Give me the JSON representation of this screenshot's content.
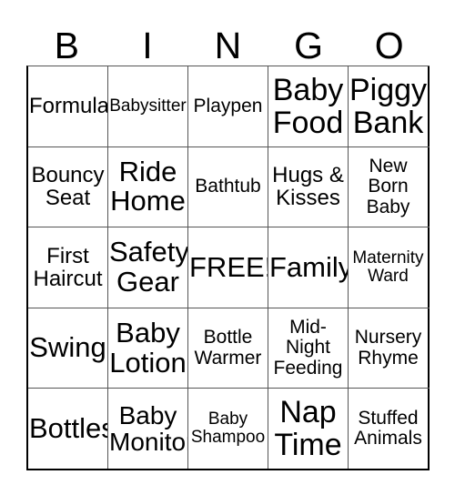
{
  "card": {
    "title_letters": [
      "B",
      "I",
      "N",
      "G",
      "O"
    ],
    "colors": {
      "background": "#ffffff",
      "text": "#000000",
      "grid_line": "#555555",
      "grid_outer": "#000000"
    },
    "rows": [
      [
        {
          "label": "Formula",
          "size": "lg"
        },
        {
          "label": "Babysitter",
          "size": "sm"
        },
        {
          "label": "Playpen",
          "size": "md"
        },
        {
          "label": "Baby Food",
          "size": "huge"
        },
        {
          "label": "Piggy Bank",
          "size": "huge"
        }
      ],
      [
        {
          "label": "Bouncy Seat",
          "size": "lg"
        },
        {
          "label": "Ride Home",
          "size": "xxl"
        },
        {
          "label": "Bathtub",
          "size": "md"
        },
        {
          "label": "Hugs & Kisses",
          "size": "lg"
        },
        {
          "label": "New Born Baby",
          "size": "md"
        }
      ],
      [
        {
          "label": "First Haircut",
          "size": "lg"
        },
        {
          "label": "Safety Gear",
          "size": "xxl"
        },
        {
          "label": "FREE!",
          "size": "xxl"
        },
        {
          "label": "Family",
          "size": "xxl"
        },
        {
          "label": "Maternity Ward",
          "size": "sm"
        }
      ],
      [
        {
          "label": "Swing",
          "size": "xxl"
        },
        {
          "label": "Baby Lotion",
          "size": "xxl"
        },
        {
          "label": "Bottle Warmer",
          "size": "md"
        },
        {
          "label": "Mid-Night Feeding",
          "size": "md"
        },
        {
          "label": "Nursery Rhyme",
          "size": "md"
        }
      ],
      [
        {
          "label": "Bottles",
          "size": "xxl"
        },
        {
          "label": "Baby Monitor",
          "size": "xl"
        },
        {
          "label": "Baby Shampoo",
          "size": "sm"
        },
        {
          "label": "Nap Time",
          "size": "huge"
        },
        {
          "label": "Stuffed Animals",
          "size": "md"
        }
      ]
    ]
  }
}
